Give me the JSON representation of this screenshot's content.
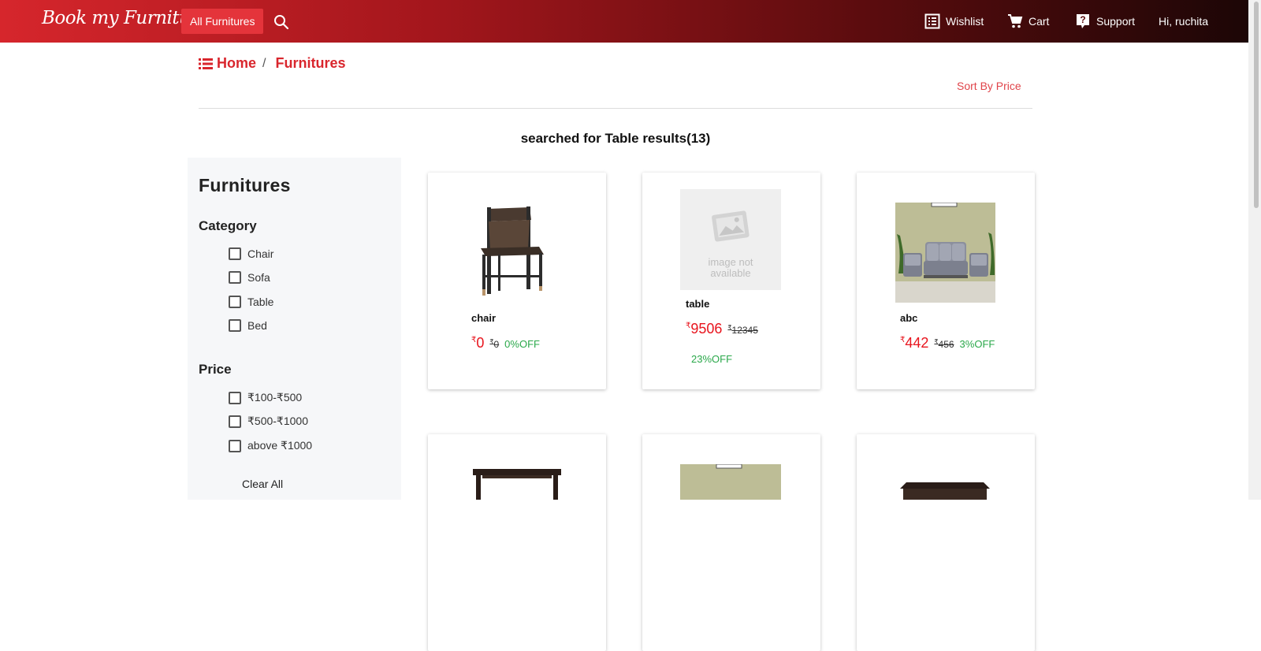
{
  "nav": {
    "brand": "Book my Furniture",
    "all_button": "All Furnitures",
    "wishlist": "Wishlist",
    "cart": "Cart",
    "support": "Support",
    "user": "Hi, ruchita"
  },
  "breadcrumb": {
    "home": "Home",
    "sep": "/",
    "current": "Furnitures"
  },
  "sort_label": "Sort By Price",
  "results_text": "searched for Table results(13)",
  "sidebar": {
    "title": "Furnitures",
    "category_heading": "Category",
    "categories": [
      "Chair",
      "Sofa",
      "Table",
      "Bed"
    ],
    "price_heading": "Price",
    "prices": [
      "₹100-₹500",
      "₹500-₹1000",
      "above ₹1000"
    ],
    "clear": "Clear All"
  },
  "currency": "₹",
  "products": [
    {
      "name": "chair",
      "price": "0",
      "old_price": "0",
      "off": "0%OFF",
      "image": "chair-image"
    },
    {
      "name": "table",
      "price": "9506",
      "old_price": "12345",
      "off": "23%OFF",
      "image": "placeholder-image",
      "placeholder_text_1": "image not",
      "placeholder_text_2": "available"
    },
    {
      "name": "abc",
      "price": "442",
      "old_price": "456",
      "off": "3%OFF",
      "image": "sofa-image"
    }
  ],
  "colors": {
    "accent": "#d9262d",
    "price": "#e8141d",
    "discount": "#2aa84a"
  }
}
